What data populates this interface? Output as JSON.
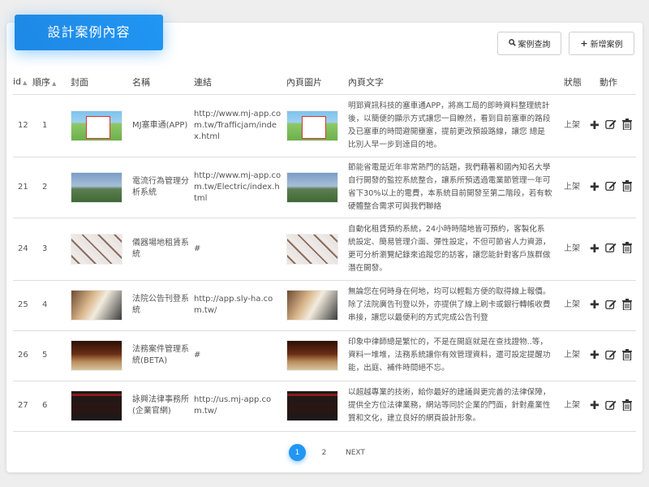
{
  "header": {
    "title": "設計案例內容"
  },
  "toolbar": {
    "search_label": "案例查詢",
    "add_label": "新增案例"
  },
  "table": {
    "columns": [
      "id",
      "順序",
      "封面",
      "名稱",
      "連結",
      "內頁圖片",
      "內頁文字",
      "狀態",
      "動作"
    ],
    "rows": [
      {
        "id": "12",
        "order": "1",
        "name": "MJ塞車通(APP)",
        "link": "http://www.mj-app.com.tw/Trafficjam/index.html",
        "text": "明郅資訊科技的塞車通APP，將高工局的即時資料整理統計後，以簡便的顯示方式讓您一目瞭然，看到目前塞車的路段及已塞車的時間避開壅塞，提前更改預設路線，讓您 總是比別人早一步到達目的地。",
        "status": "上架"
      },
      {
        "id": "21",
        "order": "2",
        "name": "電流行為管理分析系統",
        "link": "http://www.mj-app.com.tw/Electric/index.html",
        "text": "節能省電是近年非常熱門的話題，我們藉著和國內知名大學自行開發的監控系統整合，讓系所預透過電業節管理一年可省下30%以上的電費，本系統目前開發至第二階段，若有軟硬體整合需求可與我們聯絡",
        "status": "上架"
      },
      {
        "id": "24",
        "order": "3",
        "name": "儀器場地租賃系統",
        "link": "#",
        "text": "自動化租賃預約系統，24小時時隨地皆可預約，客製化系統設定、簡易管理介面、彈性設定，不但可節省人力資源，更可分析瀏覽紀錄來追蹤您的訪客，讓您能針對客戶族群做潛在開發。",
        "status": "上架"
      },
      {
        "id": "25",
        "order": "4",
        "name": "法院公告刊登系統",
        "link": "http://app.sly-ha.com.tw/",
        "text": "無論您在何時身在何地，均可以輕鬆方便的取得線上報價。除了法院廣告刊登以外，亦提供了線上刷卡或銀行轉帳收費串接，讓您以最便利的方式完成公告刊登",
        "status": "上架"
      },
      {
        "id": "26",
        "order": "5",
        "name": "法務案件管理系統(BETA)",
        "link": "#",
        "text": "印象中律師總是繁忙的，不是在開庭就是在查找證物..等，資料一堆堆，法務系統讓你有效管理資料，還可設定提醒功能，出庭、補件時間絕不忘。",
        "status": "上架"
      },
      {
        "id": "27",
        "order": "6",
        "name": "詠興法律事務所(企業官網)",
        "link": "http://us.mj-app.com.tw/",
        "text": "以超越專業的技術，給你最好的建議與更完善的法律保障，提供全方位法律業務，網站等同於企業的門面，針對產業性質和文化，建立良好的網頁設計形象。",
        "status": "上架"
      }
    ]
  },
  "pagination": {
    "pages": [
      "1",
      "2"
    ],
    "next": "NEXT"
  },
  "colors": {
    "accent": "#2196f3"
  }
}
